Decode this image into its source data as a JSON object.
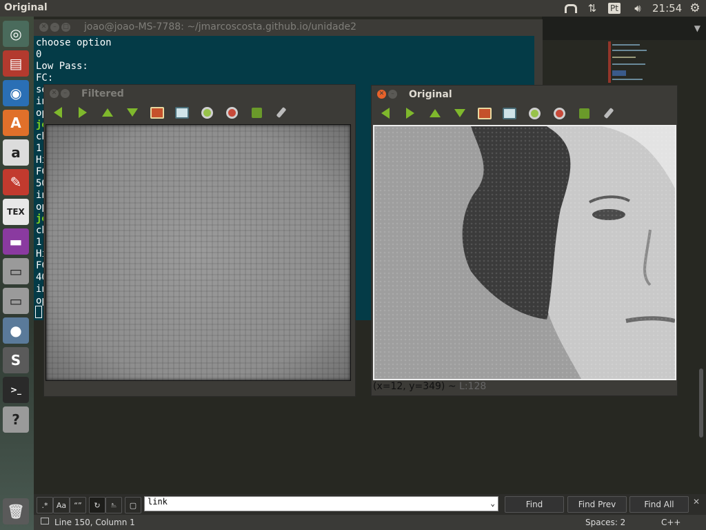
{
  "top_panel": {
    "app_title": "Original",
    "keyboard_layout": "Pt",
    "clock": "21:54"
  },
  "launcher": {
    "items": [
      {
        "name": "dash-icon",
        "glyph": "◎",
        "bg": "#4a6b5c"
      },
      {
        "name": "files-icon",
        "glyph": "▤",
        "bg": "#b33a2e"
      },
      {
        "name": "chrome-icon",
        "glyph": "◉",
        "bg": "#2a6fb5"
      },
      {
        "name": "software-center-icon",
        "glyph": "A",
        "bg": "#e0702a"
      },
      {
        "name": "amazon-icon",
        "glyph": "a",
        "bg": "#dcdcdc"
      },
      {
        "name": "system-settings-icon",
        "glyph": "✎",
        "bg": "#c23a2e"
      },
      {
        "name": "texmaker-icon",
        "glyph": "TEX",
        "bg": "#e8e8e8"
      },
      {
        "name": "workspace-icon",
        "glyph": "▬",
        "bg": "#8a3aa0"
      },
      {
        "name": "drive-icon",
        "glyph": "▭",
        "bg": "#9a9a9a"
      },
      {
        "name": "drive-2-icon",
        "glyph": "▭",
        "bg": "#9a9a9a"
      },
      {
        "name": "network-icon",
        "glyph": "●",
        "bg": "#5a7a9a"
      },
      {
        "name": "sublime-icon",
        "glyph": "S",
        "bg": "#5a5a5a"
      },
      {
        "name": "terminal-icon",
        "glyph": ">_",
        "bg": "#2a2a2a"
      },
      {
        "name": "help-icon",
        "glyph": "?",
        "bg": "#9a9a9a"
      }
    ],
    "trash_glyph": "🗑"
  },
  "terminal": {
    "title": "joao@joao-MS-7788: ~/jmarcoscosta.github.io/unidade2",
    "lines": [
      "choose option",
      "0",
      "Low Pass:",
      "FC:",
      "se",
      "in",
      "op",
      "jo",
      "ch",
      "1",
      "Hi",
      "FC",
      "50",
      "in",
      "op",
      "jo",
      "ch",
      "1",
      "Hi",
      "FC",
      "40",
      "in",
      "op"
    ]
  },
  "filtered_window": {
    "title": "Filtered"
  },
  "original_window": {
    "title": "Original",
    "status_coords": "(x=12, y=349) ~",
    "status_value": "L:128"
  },
  "find_bar": {
    "regex_label": ".*",
    "case_label": "Aa",
    "word_label": "“”",
    "input_value": "link",
    "find_label": "Find",
    "find_prev_label": "Find Prev",
    "find_all_label": "Find All",
    "close_glyph": "✕"
  },
  "status_bar": {
    "position": "Line 150, Column 1",
    "indent": "Spaces: 2",
    "syntax": "C++"
  }
}
